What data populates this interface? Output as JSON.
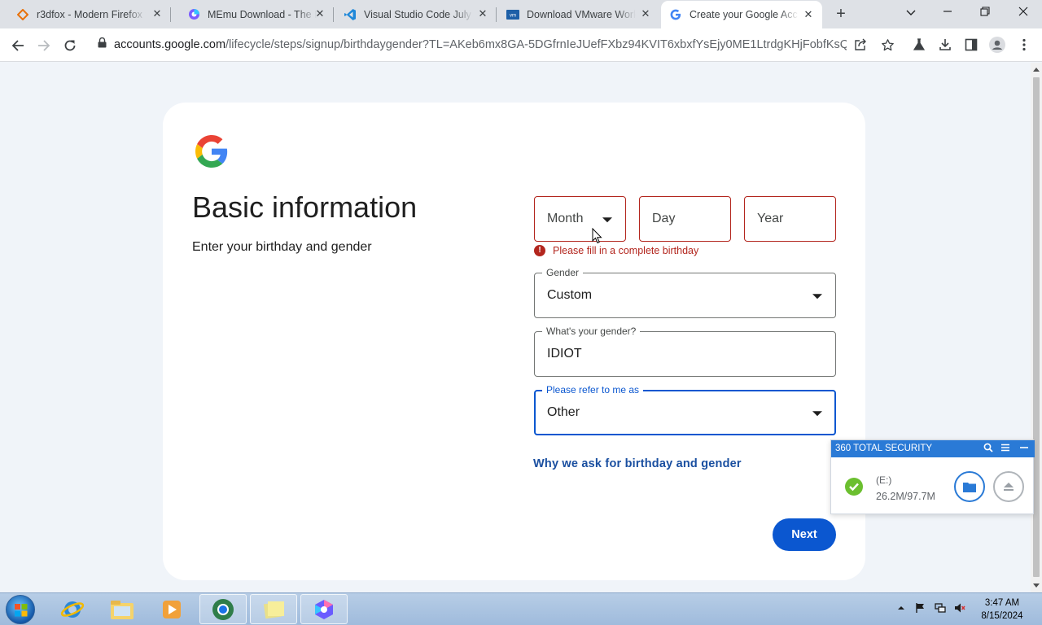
{
  "browser": {
    "tabs": [
      {
        "title": "r3dfox - Modern Firefox f",
        "icon": "r3dfox-icon",
        "active": false
      },
      {
        "title": "MEmu Download - The B",
        "icon": "memu-icon",
        "active": false
      },
      {
        "title": "Visual Studio Code July 2",
        "icon": "vscode-icon",
        "active": false
      },
      {
        "title": "Download VMware Work",
        "icon": "vmware-icon",
        "active": false
      },
      {
        "title": "Create your Google Acc",
        "icon": "google-icon",
        "active": true
      }
    ],
    "new_tab_symbol": "+",
    "url_host": "accounts.google.com",
    "url_path": "/lifecycle/steps/signup/birthdaygender?TL=AKeb6mx8GA-5DGfrnIeJUefFXbz94KVIT6xbxfYsEjy0ME1LtrdgKHjFobfKsQdw&c..."
  },
  "page": {
    "title": "Basic information",
    "subtitle": "Enter your birthday and gender",
    "birthday": {
      "month_placeholder": "Month",
      "day_placeholder": "Day",
      "year_placeholder": "Year",
      "error": "Please fill in a complete birthday",
      "error_icon": "!"
    },
    "gender": {
      "label": "Gender",
      "value": "Custom"
    },
    "custom_gender": {
      "label": "What's your gender?",
      "value": "IDIOT"
    },
    "pronoun": {
      "label": "Please refer to me as",
      "value": "Other"
    },
    "why_link": "Why we ask for birthday and gender",
    "next_button": "Next"
  },
  "security_popup": {
    "title": "360 TOTAL SECURITY",
    "drive": "(E:)",
    "usage": "26.2M/97.7M"
  },
  "taskbar": {
    "time": "3:47 AM",
    "date": "8/15/2024"
  },
  "colors": {
    "accent": "#0b57d0",
    "error": "#b3261e",
    "security_bar": "#2a7ad6"
  }
}
